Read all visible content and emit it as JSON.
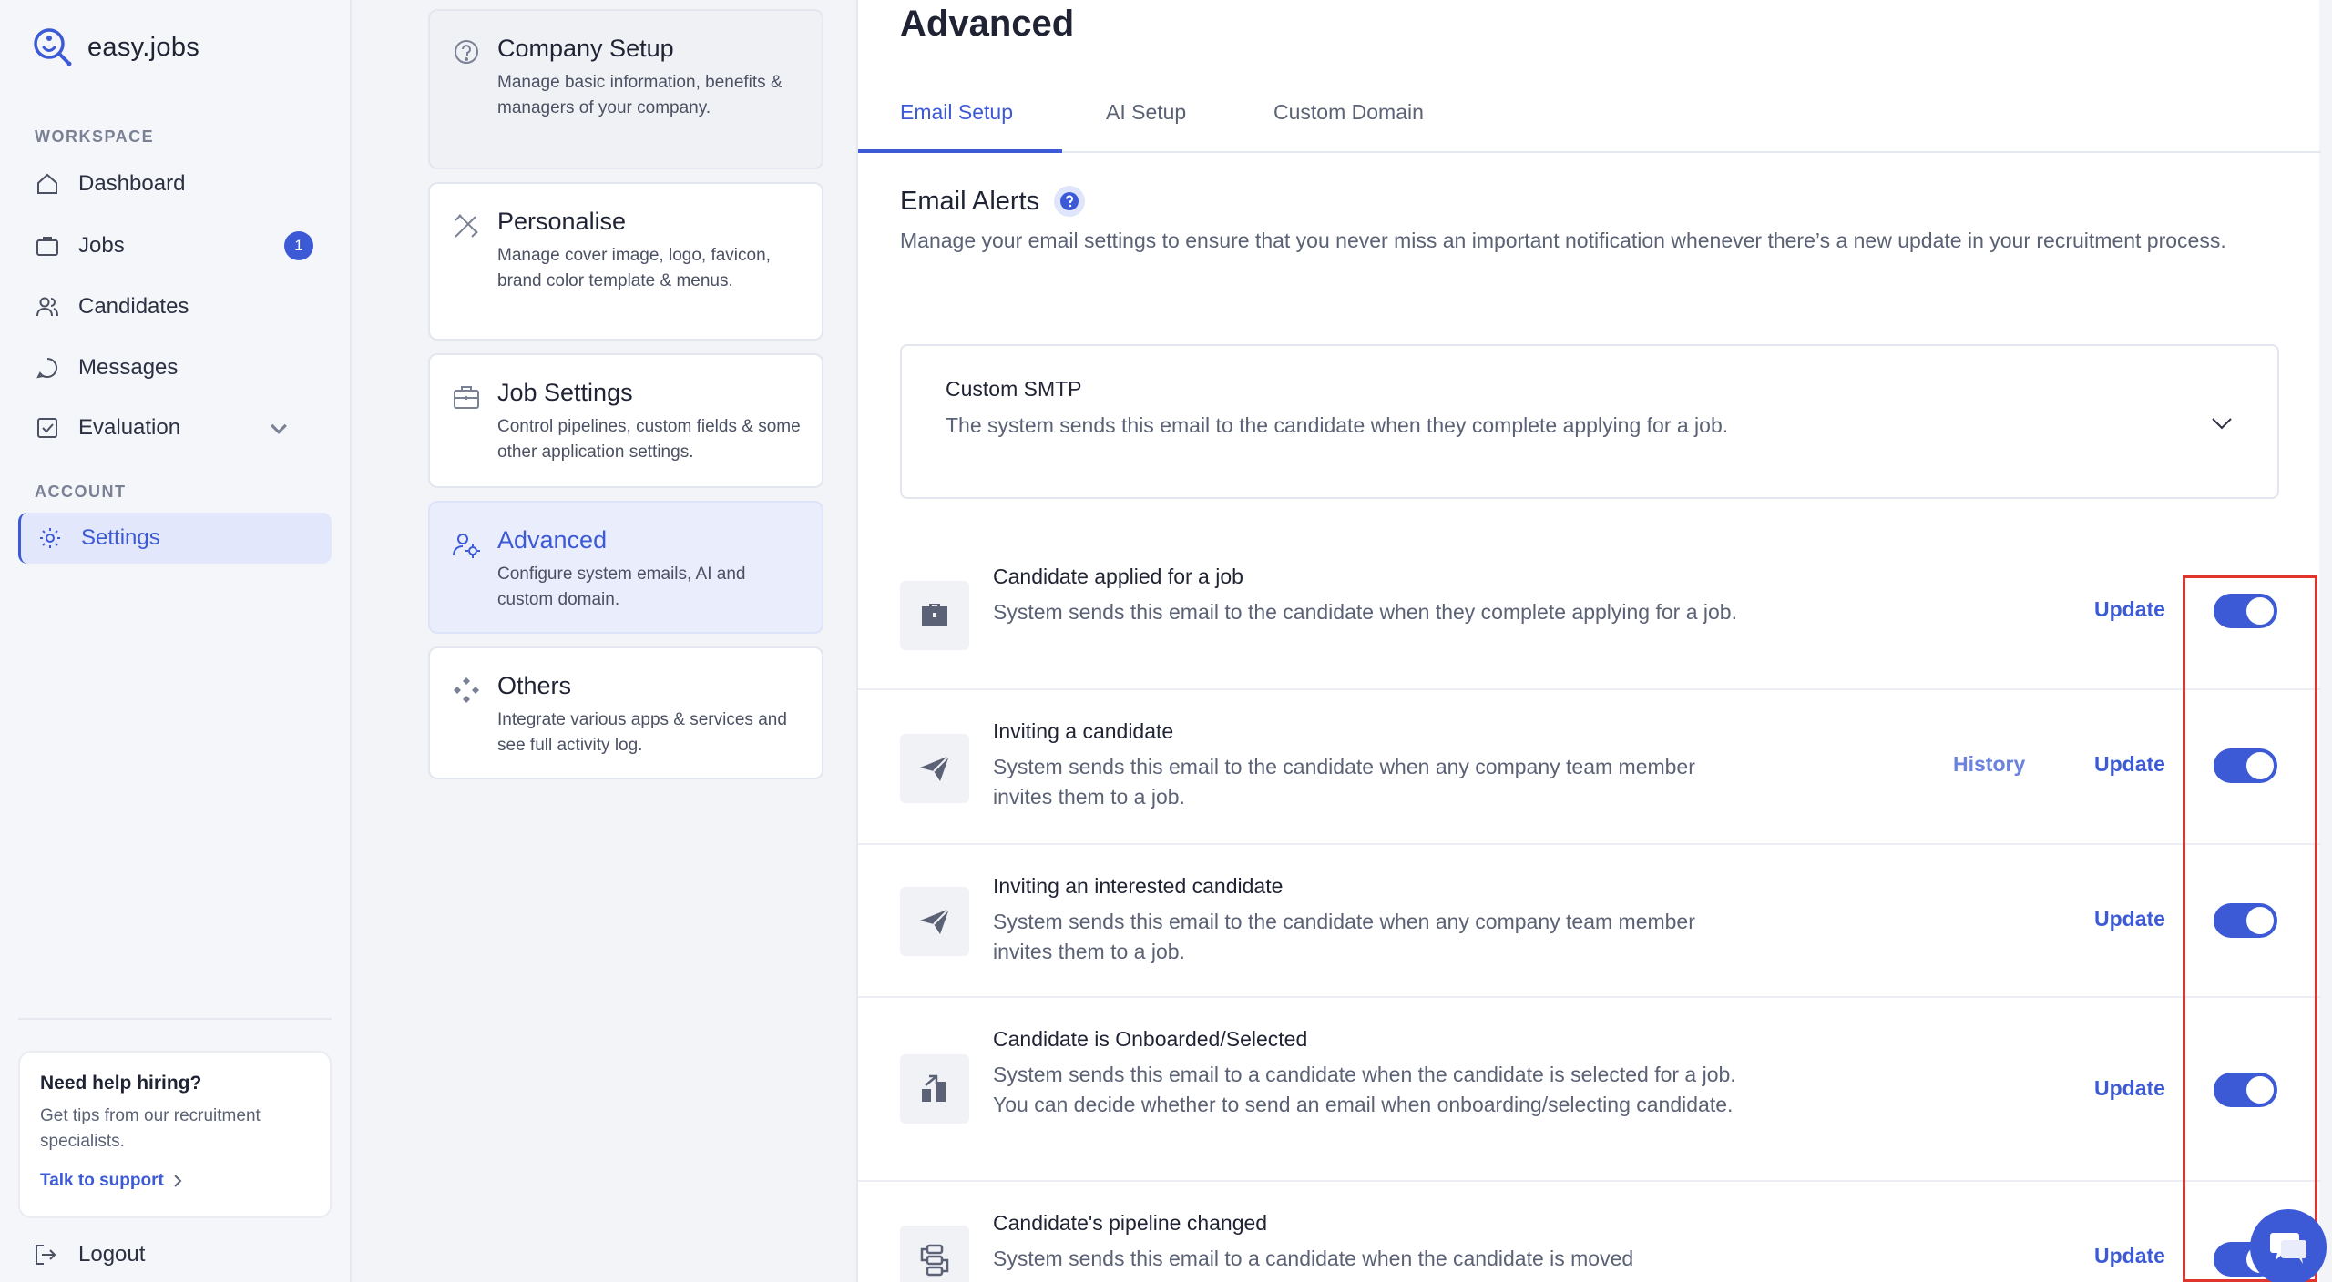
{
  "brand": {
    "name": "easy.jobs",
    "accent": "#3c5ad6"
  },
  "sidebar": {
    "workspace_label": "WORKSPACE",
    "account_label": "ACCOUNT",
    "items": [
      {
        "label": "Dashboard",
        "icon": "home-icon"
      },
      {
        "label": "Jobs",
        "icon": "briefcase-icon",
        "badge": "1"
      },
      {
        "label": "Candidates",
        "icon": "users-icon"
      },
      {
        "label": "Messages",
        "icon": "message-icon"
      },
      {
        "label": "Evaluation",
        "icon": "checklist-icon",
        "expandable": true
      }
    ],
    "settings_label": "Settings",
    "help": {
      "title": "Need help hiring?",
      "text": "Get tips from our recruitment specialists.",
      "link": "Talk to support"
    },
    "logout_label": "Logout"
  },
  "settings_menu": [
    {
      "title": "Company Setup",
      "desc": "Manage basic information, benefits & managers of your company.",
      "icon": "question-bubble-icon"
    },
    {
      "title": "Personalise",
      "desc": "Manage cover image, logo, favicon, brand color template & menus.",
      "icon": "design-tools-icon"
    },
    {
      "title": "Job Settings",
      "desc": "Control pipelines, custom fields & some other application settings.",
      "icon": "briefcase-settings-icon"
    },
    {
      "title": "Advanced",
      "desc": "Configure system emails, AI and custom domain.",
      "icon": "user-gear-icon",
      "active": true
    },
    {
      "title": "Others",
      "desc": "Integrate various apps & services and see full activity log.",
      "icon": "apps-icon"
    }
  ],
  "main": {
    "title": "Advanced",
    "tabs": [
      "Email Setup",
      "AI Setup",
      "Custom Domain"
    ],
    "active_tab": "Email Setup",
    "alerts_title": "Email Alerts",
    "alerts_desc": "Manage your email settings to ensure that you never miss an important notification whenever there’s a new update in your recruitment process.",
    "smtp": {
      "title": "Custom SMTP",
      "desc": "The system sends this email to the candidate when they complete applying for a job."
    },
    "update_label": "Update",
    "history_label": "History",
    "rows": [
      {
        "title": "Candidate applied for a job",
        "desc": "System sends this email to the candidate when they complete applying for a job.",
        "icon": "briefcase-icon",
        "enabled": true
      },
      {
        "title": "Inviting a candidate",
        "desc": "System sends this email to the candidate when any company team member invites them to a job.",
        "icon": "paper-plane-icon",
        "enabled": true,
        "has_history": true
      },
      {
        "title": "Inviting an interested candidate",
        "desc": "System sends this email to the candidate when any company team member invites them to a job.",
        "icon": "paper-plane-icon",
        "enabled": true
      },
      {
        "title": "Candidate is Onboarded/Selected",
        "desc": "System sends this email to a candidate when the candidate is selected for a job. You can decide whether to send an email when onboarding/selecting candidate.",
        "icon": "onboard-icon",
        "enabled": true
      },
      {
        "title": "Candidate's pipeline changed",
        "desc": "System sends this email to a candidate when the candidate is moved",
        "icon": "pipeline-icon",
        "enabled": true
      }
    ]
  }
}
